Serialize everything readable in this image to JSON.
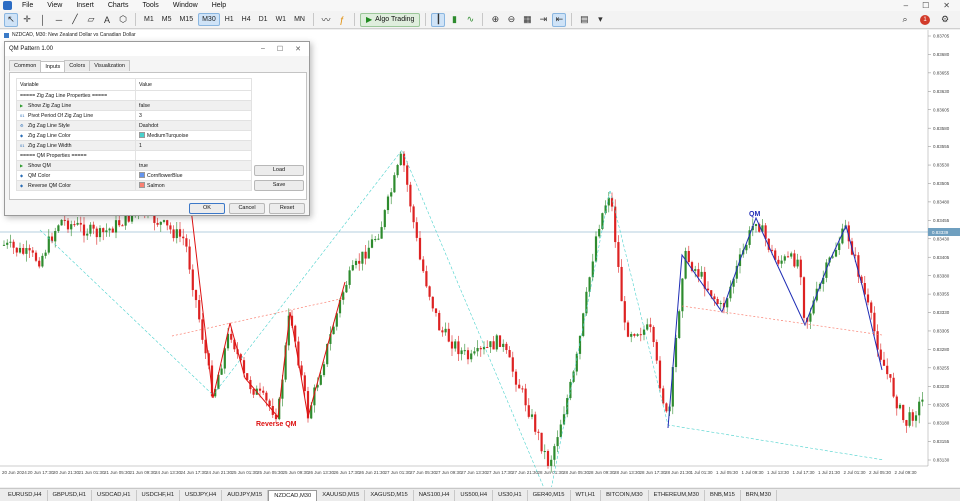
{
  "menubar": {
    "items": [
      "File",
      "View",
      "Insert",
      "Charts",
      "Tools",
      "Window",
      "Help"
    ],
    "window_buttons": [
      "–",
      "☐",
      "✕"
    ]
  },
  "toolbar": {
    "timeframes": [
      "M1",
      "M5",
      "M15",
      "M30",
      "H1",
      "H4",
      "D1",
      "W1",
      "MN"
    ],
    "active_timeframe": "M30",
    "algo_trading_label": "Algo Trading",
    "notification_count": "1"
  },
  "chart": {
    "title": "NZDCAD, M30: New Zealand Dollar vs Canadian Dollar",
    "current_price": "0.83339",
    "price_labels": [
      "0.83705",
      "0.83680",
      "0.83655",
      "0.83630",
      "0.83605",
      "0.83580",
      "0.83555",
      "0.83530",
      "0.83505",
      "0.83480",
      "0.83455",
      "0.83430",
      "0.83405",
      "0.83380",
      "0.83355",
      "0.83330",
      "0.83305",
      "0.83280",
      "0.83255",
      "0.83230",
      "0.83205",
      "0.83180",
      "0.83155",
      "0.83130"
    ],
    "time_labels": [
      "20 Jun 2024",
      "20 Jun 17:30",
      "20 Jun 21:30",
      "21 Jun 01:30",
      "21 Jun 05:30",
      "21 Jun 09:30",
      "24 Jun 13:30",
      "24 Jun 17:30",
      "24 Jun 21:30",
      "25 Jun 01:30",
      "25 Jun 05:30",
      "25 Jun 09:30",
      "26 Jun 13:30",
      "26 Jun 17:30",
      "26 Jun 21:30",
      "27 Jun 01:30",
      "27 Jun 05:30",
      "27 Jun 09:30",
      "27 Jun 13:30",
      "27 Jun 17:30",
      "27 Jun 21:30",
      "28 Jun 01:30",
      "28 Jun 05:30",
      "28 Jun 09:30",
      "28 Jun 13:30",
      "28 Jun 17:30",
      "28 Jun 21:30",
      "1 Jul 01:30",
      "1 Jul 05:30",
      "1 Jul 09:30",
      "1 Jul 13:30",
      "1 Jul 17:30",
      "1 Jul 21:30",
      "2 Jul 01:30",
      "2 Jul 05:30",
      "2 Jul 09:30"
    ],
    "annotations": {
      "qm_label": "QM",
      "reverse_qm_label": "Reverse QM"
    },
    "colors": {
      "bull": "#2e8b2e",
      "bear": "#dd2222",
      "qm_line": "#1f2db5",
      "reverse_qm_line": "#dd1111",
      "zigzag": "#48d1cc",
      "qm_color": "#6495ed",
      "reverse_qm_color": "#fa8072"
    }
  },
  "dialog": {
    "title": "QM Pattern 1.00",
    "window_buttons": [
      "–",
      "☐",
      "✕"
    ],
    "tabs": [
      "Common",
      "Inputs",
      "Colors",
      "Visualization"
    ],
    "active_tab": "Inputs",
    "table": {
      "headers": [
        "Variable",
        "Value"
      ],
      "rows": [
        {
          "type": "",
          "name": "===== Zig Zag Line Properties =====",
          "value": ""
        },
        {
          "type": "bool",
          "name": "Show Zig Zag Line",
          "value": "false"
        },
        {
          "type": "int",
          "name": "Pivot Period Of Zig Zag Line",
          "value": "3"
        },
        {
          "type": "enum",
          "name": "Zig Zag Line Style",
          "value": "Dashdot"
        },
        {
          "type": "color",
          "name": "Zig Zag Line Color",
          "value": "MediumTurquoise",
          "swatch": "#48d1cc"
        },
        {
          "type": "int",
          "name": "Zig Zag Line Width",
          "value": "1"
        },
        {
          "type": "",
          "name": "===== QM Properties =====",
          "value": ""
        },
        {
          "type": "bool",
          "name": "Show QM",
          "value": "true"
        },
        {
          "type": "color",
          "name": "QM Color",
          "value": "CornflowerBlue",
          "swatch": "#6495ed"
        },
        {
          "type": "color",
          "name": "Reverse QM Color",
          "value": "Salmon",
          "swatch": "#fa8072"
        }
      ]
    },
    "side_buttons": {
      "load": "Load",
      "save": "Save"
    },
    "footer_buttons": {
      "ok": "OK",
      "cancel": "Cancel",
      "reset": "Reset"
    }
  },
  "bottom_tabs": {
    "items": [
      "EURUSD,H4",
      "GBPUSD,H1",
      "USDCAD,H1",
      "USDCHF,H1",
      "USDJPY,H4",
      "AUDJPY,M15",
      "NZDCAD,M30",
      "XAUUSD,M15",
      "XAGUSD,M15",
      "NAS100,H4",
      "US500,H4",
      "US30,H1",
      "GER40,M15",
      "WTI,H1",
      "BITCOIN,M30",
      "ETHEREUM,M30",
      "BNB,M15",
      "BRN,M30"
    ],
    "active": "NZDCAD,M30"
  }
}
